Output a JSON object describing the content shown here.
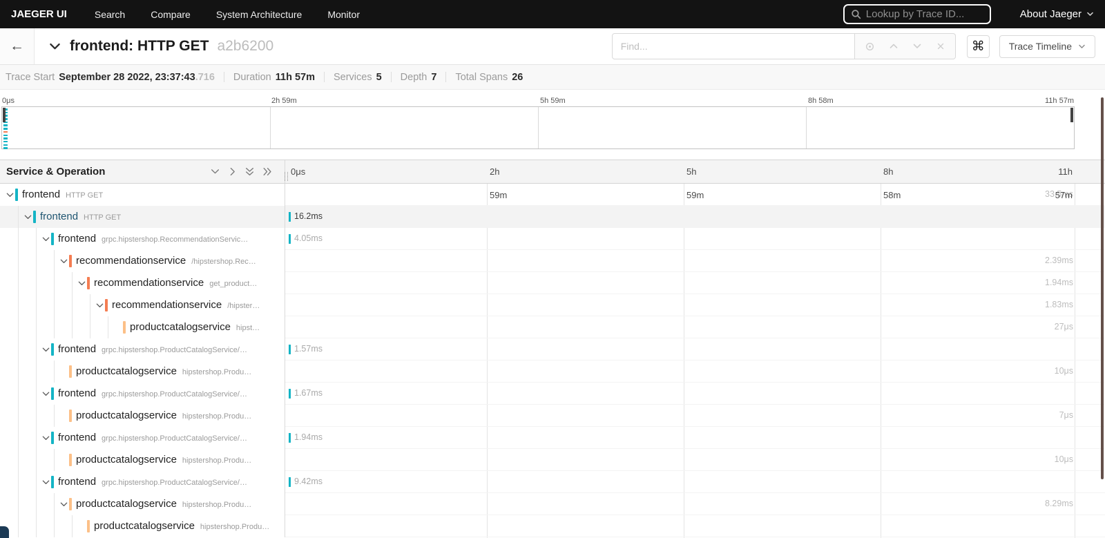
{
  "nav": {
    "brand": "JAEGER UI",
    "items": [
      "Search",
      "Compare",
      "System Architecture",
      "Monitor"
    ],
    "lookup_placeholder": "Lookup by Trace ID...",
    "about_label": "About Jaeger"
  },
  "trace_header": {
    "title": "frontend: HTTP GET",
    "trace_id": "a2b6200",
    "find_placeholder": "Find...",
    "shortcut_glyph": "⌘",
    "view_selector_label": "Trace Timeline"
  },
  "summary": {
    "trace_start_label": "Trace Start",
    "trace_start_value": "September 28 2022, 23:37:43",
    "trace_start_ms": ".716",
    "duration_label": "Duration",
    "duration_value": "11h 57m",
    "services_label": "Services",
    "services_value": "5",
    "depth_label": "Depth",
    "depth_value": "7",
    "total_spans_label": "Total Spans",
    "total_spans_value": "26"
  },
  "minimap": {
    "ticks": [
      "0μs",
      "2h 59m",
      "5h 59m",
      "8h 58m",
      "11h 57m"
    ],
    "span_marks": [
      "teal",
      "teal",
      "teal",
      "teal",
      "teal",
      "teal",
      "teal",
      "orange",
      "teal",
      "teal",
      "teal",
      "teal",
      "teal"
    ]
  },
  "table": {
    "left_header": "Service & Operation",
    "ticks": [
      {
        "l1": "0μs",
        "l2": ""
      },
      {
        "l1": "2h",
        "l2": "59m"
      },
      {
        "l1": "5h",
        "l2": "59m"
      },
      {
        "l1": "8h",
        "l2": "58m"
      },
      {
        "l1": "11h",
        "l2": "57m"
      }
    ]
  },
  "colors": {
    "teal": "#14b4c5",
    "orange": "#f47d52",
    "peach": "#fcc088"
  },
  "rows": [
    {
      "service": "frontend",
      "operation": "HTTP GET",
      "level": 0,
      "color": "teal",
      "chevron": true,
      "duration": "33.5ms",
      "side": "right",
      "selected": false
    },
    {
      "service": "frontend",
      "operation": "HTTP GET",
      "level": 1,
      "color": "teal",
      "chevron": true,
      "duration": "16.2ms",
      "side": "left",
      "selected": true
    },
    {
      "service": "frontend",
      "operation": "grpc.hipstershop.RecommendationServic…",
      "level": 2,
      "color": "teal",
      "chevron": true,
      "duration": "4.05ms",
      "side": "left",
      "selected": false
    },
    {
      "service": "recommendationservice",
      "operation": "/hipstershop.Rec…",
      "level": 3,
      "color": "orange",
      "chevron": true,
      "duration": "2.39ms",
      "side": "right",
      "selected": false
    },
    {
      "service": "recommendationservice",
      "operation": "get_product…",
      "level": 4,
      "color": "orange",
      "chevron": true,
      "duration": "1.94ms",
      "side": "right",
      "selected": false
    },
    {
      "service": "recommendationservice",
      "operation": "/hipster…",
      "level": 5,
      "color": "orange",
      "chevron": true,
      "duration": "1.83ms",
      "side": "right",
      "selected": false
    },
    {
      "service": "productcatalogservice",
      "operation": "hipst…",
      "level": 6,
      "color": "peach",
      "chevron": false,
      "duration": "27μs",
      "side": "right",
      "selected": false
    },
    {
      "service": "frontend",
      "operation": "grpc.hipstershop.ProductCatalogService/…",
      "level": 2,
      "color": "teal",
      "chevron": true,
      "duration": "1.57ms",
      "side": "left",
      "selected": false
    },
    {
      "service": "productcatalogservice",
      "operation": "hipstershop.Produ…",
      "level": 3,
      "color": "peach",
      "chevron": false,
      "duration": "10μs",
      "side": "right",
      "selected": false
    },
    {
      "service": "frontend",
      "operation": "grpc.hipstershop.ProductCatalogService/…",
      "level": 2,
      "color": "teal",
      "chevron": true,
      "duration": "1.67ms",
      "side": "left",
      "selected": false
    },
    {
      "service": "productcatalogservice",
      "operation": "hipstershop.Produ…",
      "level": 3,
      "color": "peach",
      "chevron": false,
      "duration": "7μs",
      "side": "right",
      "selected": false
    },
    {
      "service": "frontend",
      "operation": "grpc.hipstershop.ProductCatalogService/…",
      "level": 2,
      "color": "teal",
      "chevron": true,
      "duration": "1.94ms",
      "side": "left",
      "selected": false
    },
    {
      "service": "productcatalogservice",
      "operation": "hipstershop.Produ…",
      "level": 3,
      "color": "peach",
      "chevron": false,
      "duration": "10μs",
      "side": "right",
      "selected": false
    },
    {
      "service": "frontend",
      "operation": "grpc.hipstershop.ProductCatalogService/…",
      "level": 2,
      "color": "teal",
      "chevron": true,
      "duration": "9.42ms",
      "side": "left",
      "selected": false
    },
    {
      "service": "productcatalogservice",
      "operation": "hipstershop.Produ…",
      "level": 3,
      "color": "peach",
      "chevron": true,
      "duration": "8.29ms",
      "side": "right",
      "selected": false
    },
    {
      "service": "productcatalogservice",
      "operation": "hipstershop.Produ…",
      "level": 4,
      "color": "peach",
      "chevron": false,
      "duration": "",
      "side": "none",
      "selected": false
    }
  ]
}
